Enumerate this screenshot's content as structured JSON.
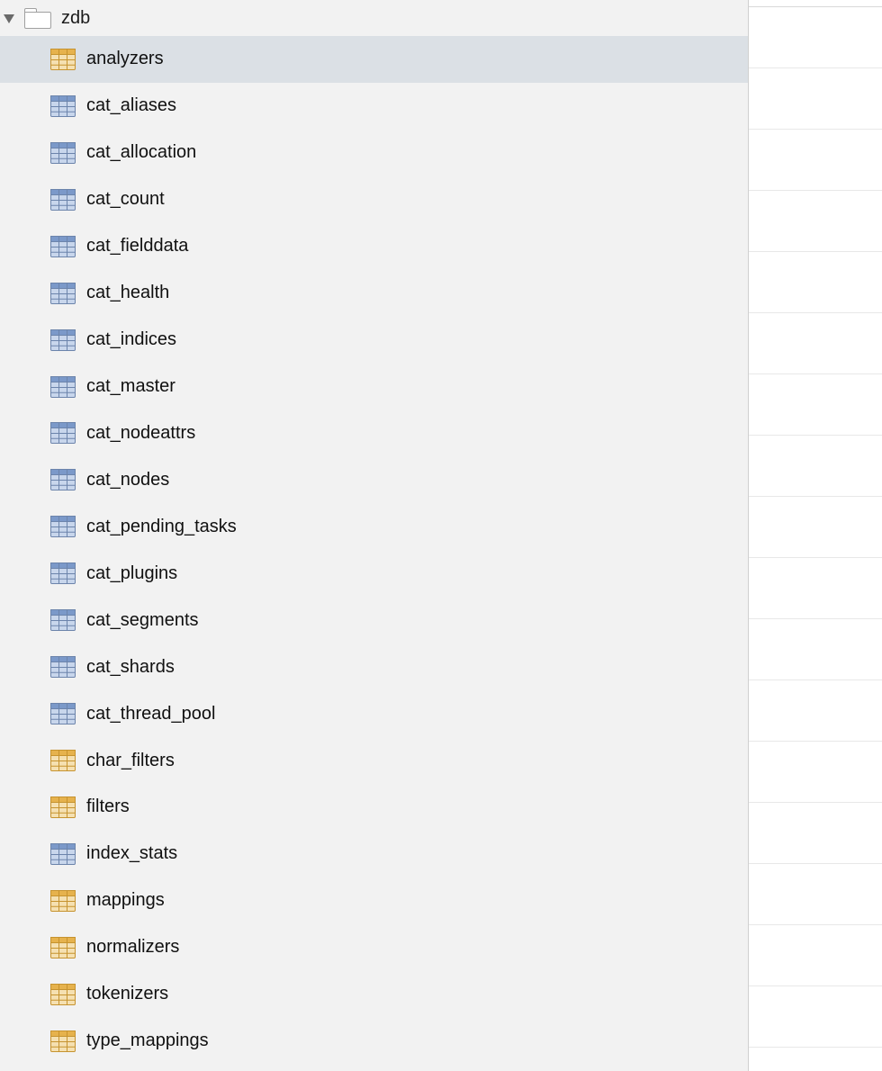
{
  "schema": {
    "name": "zdb",
    "expanded": true
  },
  "items": [
    {
      "name": "analyzers",
      "icon": "orange",
      "selected": true
    },
    {
      "name": "cat_aliases",
      "icon": "blue",
      "selected": false
    },
    {
      "name": "cat_allocation",
      "icon": "blue",
      "selected": false
    },
    {
      "name": "cat_count",
      "icon": "blue",
      "selected": false
    },
    {
      "name": "cat_fielddata",
      "icon": "blue",
      "selected": false
    },
    {
      "name": "cat_health",
      "icon": "blue",
      "selected": false
    },
    {
      "name": "cat_indices",
      "icon": "blue",
      "selected": false
    },
    {
      "name": "cat_master",
      "icon": "blue",
      "selected": false
    },
    {
      "name": "cat_nodeattrs",
      "icon": "blue",
      "selected": false
    },
    {
      "name": "cat_nodes",
      "icon": "blue",
      "selected": false
    },
    {
      "name": "cat_pending_tasks",
      "icon": "blue",
      "selected": false
    },
    {
      "name": "cat_plugins",
      "icon": "blue",
      "selected": false
    },
    {
      "name": "cat_segments",
      "icon": "blue",
      "selected": false
    },
    {
      "name": "cat_shards",
      "icon": "blue",
      "selected": false
    },
    {
      "name": "cat_thread_pool",
      "icon": "blue",
      "selected": false
    },
    {
      "name": "char_filters",
      "icon": "orange",
      "selected": false
    },
    {
      "name": "filters",
      "icon": "orange",
      "selected": false
    },
    {
      "name": "index_stats",
      "icon": "blue",
      "selected": false
    },
    {
      "name": "mappings",
      "icon": "orange",
      "selected": false
    },
    {
      "name": "normalizers",
      "icon": "orange",
      "selected": false
    },
    {
      "name": "tokenizers",
      "icon": "orange",
      "selected": false
    },
    {
      "name": "type_mappings",
      "icon": "orange",
      "selected": false
    }
  ],
  "iconColors": {
    "blue": {
      "header": "#7b99c9",
      "body": "#c8d6ec",
      "border": "#6c84ab"
    },
    "orange": {
      "header": "#e6b24d",
      "body": "#f5e0b1",
      "border": "#c6932f"
    }
  }
}
